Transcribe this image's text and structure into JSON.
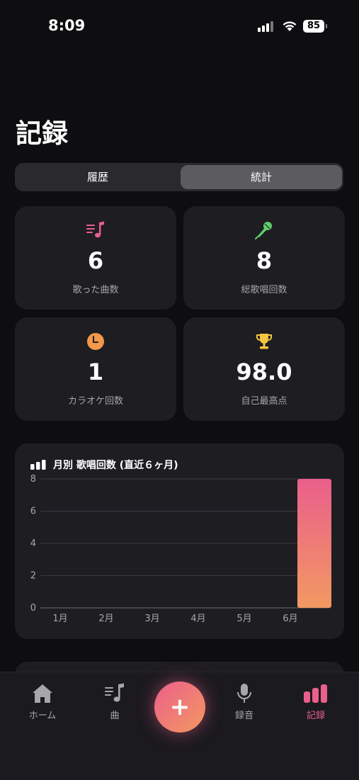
{
  "status_bar": {
    "time": "8:09",
    "battery": "85"
  },
  "page": {
    "title": "記録"
  },
  "segments": {
    "history": "履歴",
    "stats": "統計",
    "selected": "統計"
  },
  "stats": [
    {
      "icon": "music-list-icon",
      "value": "6",
      "label": "歌った曲数",
      "color": "#ea5f8c"
    },
    {
      "icon": "microphone-icon",
      "value": "8",
      "label": "総歌唱回数",
      "color": "#5fcf6b"
    },
    {
      "icon": "clock-icon",
      "value": "1",
      "label": "カラオケ回数",
      "color": "#f2994a"
    },
    {
      "icon": "trophy-icon",
      "value": "98.0",
      "label": "自己最高点",
      "color": "#f5c542"
    }
  ],
  "chart": {
    "title": "月別 歌唱回数 (直近６ヶ月)",
    "icon": "bar-chart-icon"
  },
  "chart_data": {
    "type": "bar",
    "categories": [
      "1月",
      "2月",
      "3月",
      "4月",
      "5月",
      "6月"
    ],
    "values": [
      0,
      0,
      0,
      0,
      0,
      8
    ],
    "ylim": [
      0,
      8
    ],
    "yticks": [
      0,
      2,
      4,
      6,
      8
    ],
    "grid": true,
    "bar_gradient": [
      "#ea5f8c",
      "#f29961"
    ]
  },
  "tabs": [
    {
      "icon": "home-icon",
      "label": "ホーム"
    },
    {
      "icon": "music-note-icon",
      "label": "曲"
    },
    {
      "icon": "microphone-icon",
      "label": "録音"
    },
    {
      "icon": "stats-icon",
      "label": "記録",
      "active": true
    }
  ],
  "fab": {
    "label": "+"
  },
  "colors": {
    "accent": "#ea5f8c",
    "background": "#0e0d10",
    "card": "#1e1d22"
  }
}
